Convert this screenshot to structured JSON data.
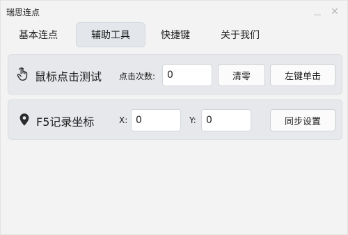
{
  "app": {
    "title": "瑞思连点"
  },
  "window_controls": {
    "minimize": "—",
    "close": "✕"
  },
  "tabs": [
    {
      "label": "基本连点",
      "active": false
    },
    {
      "label": "辅助工具",
      "active": true
    },
    {
      "label": "快捷键",
      "active": false
    },
    {
      "label": "关于我们",
      "active": false
    }
  ],
  "click_test": {
    "icon": "pointer-hand-icon",
    "heading": "鼠标点击测试",
    "count_label": "点击次数:",
    "count_value": "0",
    "clear_label": "清零",
    "left_click_label": "左键单击"
  },
  "record_coords": {
    "icon": "location-pin-icon",
    "heading": "F5记录坐标",
    "x_label": "X:",
    "x_value": "0",
    "y_label": "Y:",
    "y_value": "0",
    "sync_label": "同步设置"
  },
  "colors": {
    "window_bg": "#f3f3f3",
    "panel_bg": "#e6e8eb",
    "tab_active_bg": "#e3e6ea",
    "icon_dark": "#2b2b2b"
  }
}
